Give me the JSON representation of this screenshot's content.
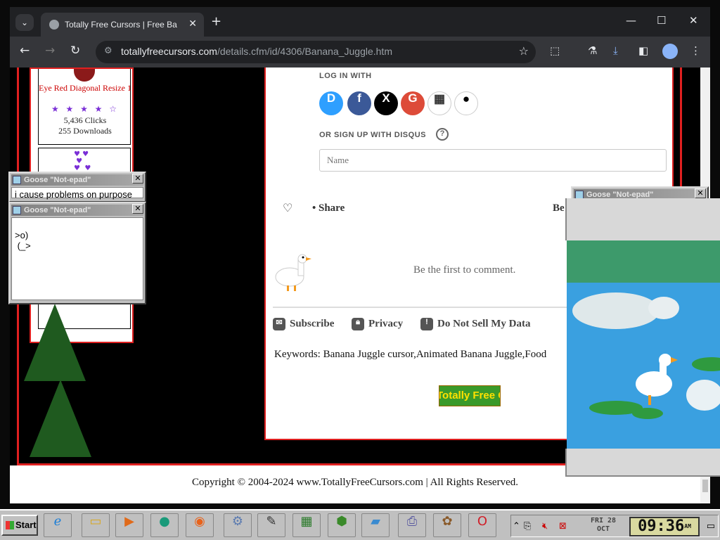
{
  "browser": {
    "tab_title": "Totally Free Cursors | Free Banana",
    "tab_close": "✕",
    "new_tab": "+",
    "url_domain": "totallyfreecursors.com",
    "url_path": "/details.cfm/id/4306/Banana_Juggle.htm"
  },
  "sidebar": {
    "cursor_name": "Eye Red Diagonal Resize 1",
    "rating": "★ ★ ★ ★ ☆",
    "clicks": "5,436 Clicks",
    "downloads": "255 Downloads"
  },
  "comments": {
    "login_label": "LOG IN WITH",
    "social": [
      {
        "letter": "D",
        "color": "#2e9fff"
      },
      {
        "letter": "f",
        "color": "#3b5998"
      },
      {
        "letter": "X",
        "color": "#000000"
      },
      {
        "letter": "G",
        "color": "#dd4b39"
      },
      {
        "letter": "▦",
        "color": "#ffffff"
      },
      {
        "letter": "",
        "color": "#ffffff"
      }
    ],
    "signup_label": "OR SIGN UP WITH DISQUS",
    "help_mark": "?",
    "name_placeholder": "Name",
    "share_label": "• Share",
    "sort_label": "Be",
    "empty_text": "Be the first to comment.",
    "subscribe": "Subscribe",
    "privacy": "Privacy",
    "do_not_sell": "Do Not Sell My Data"
  },
  "page": {
    "keywords": "Keywords: Banana Juggle cursor,Animated Banana Juggle,Food",
    "banner_text": "Totally Free Cursors",
    "copyright": "Copyright © 2004-2024 www.TotallyFreeCursors.com | All Rights Reserved."
  },
  "notepads": [
    {
      "title": "Goose \"Not-epad\"",
      "text": "i cause problems on purpose"
    },
    {
      "title": "Goose \"Not-epad\"",
      "text": "\n>o)\n (_>"
    },
    {
      "title": "Goose \"Not-epad\"",
      "text": ""
    }
  ],
  "taskbar": {
    "start_label": "Start",
    "date": "FRI 28 OCT",
    "time": "09:36",
    "ampm": "AM"
  }
}
